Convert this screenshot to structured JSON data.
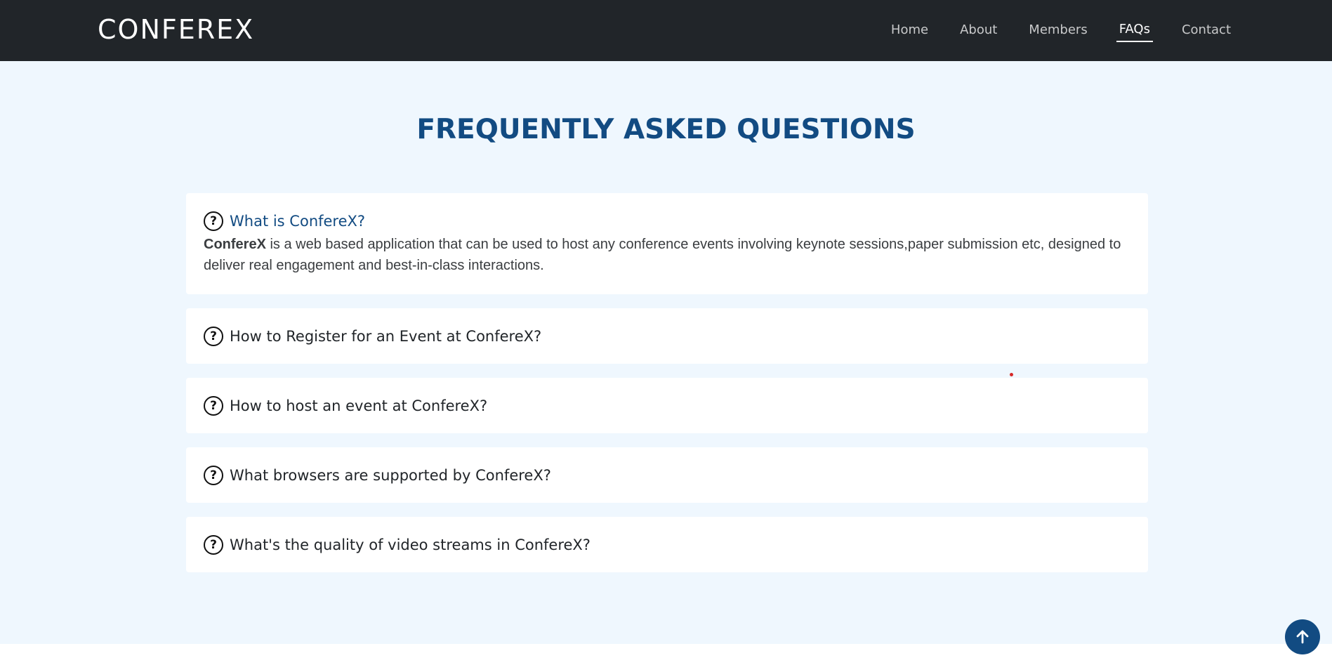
{
  "header": {
    "brand": "CONFEREX",
    "nav": [
      {
        "label": "Home"
      },
      {
        "label": "About"
      },
      {
        "label": "Members"
      },
      {
        "label": "FAQs",
        "active": true
      },
      {
        "label": "Contact"
      }
    ]
  },
  "faq": {
    "title": "FREQUENTLY ASKED QUESTIONS",
    "items": [
      {
        "question": "What is ConfereX?",
        "open": true,
        "answer_bold": "ConfereX",
        "answer_rest": " is a web based application that can be used to host any conference events involving keynote sessions,paper submission etc, designed to deliver real engagement and best-in-class interactions."
      },
      {
        "question": "How to Register for an Event at ConfereX?"
      },
      {
        "question": "How to host an event at ConfereX?"
      },
      {
        "question": "What browsers are supported by ConfereX?"
      },
      {
        "question": "What's the quality of video streams in ConfereX?"
      }
    ]
  },
  "icons": {
    "question": "question-circle-icon",
    "back_to_top": "arrow-up-icon"
  },
  "colors": {
    "navbar_bg": "#212529",
    "page_bg": "#eff7fe",
    "accent": "#124b82"
  }
}
